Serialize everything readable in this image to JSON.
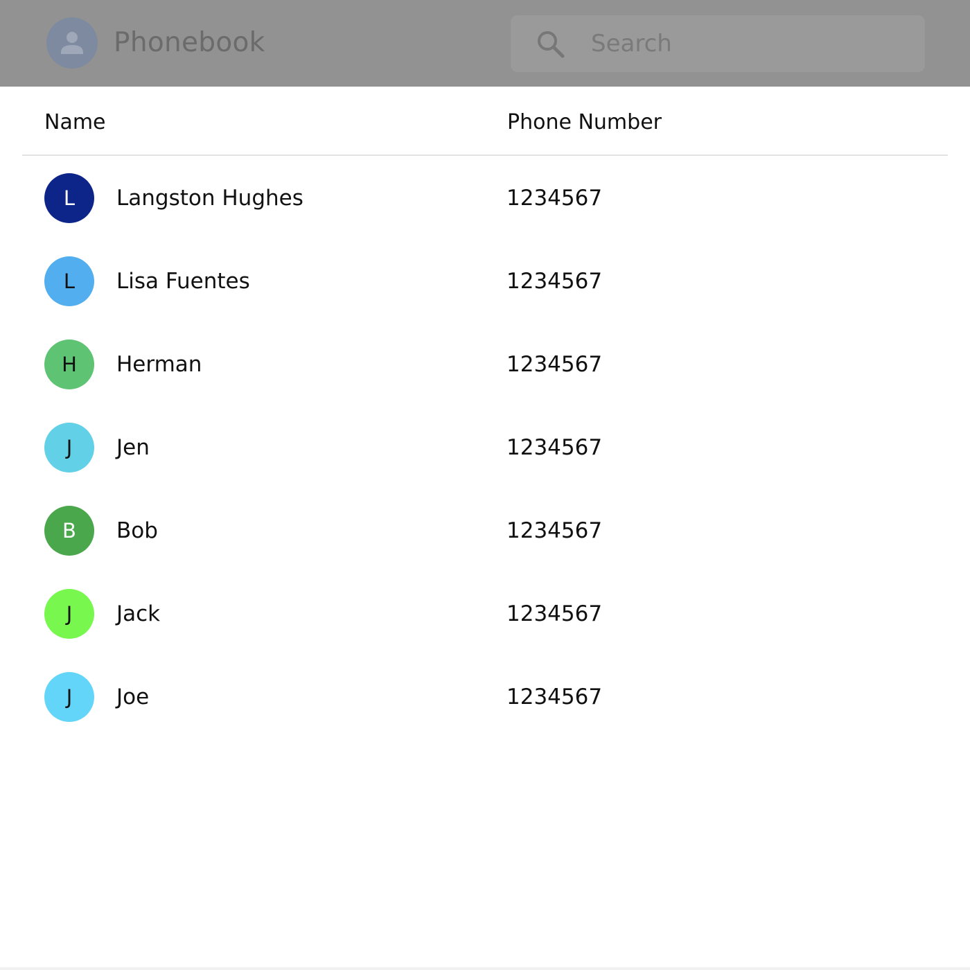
{
  "header": {
    "title": "Phonebook",
    "search_placeholder": "Search",
    "colors": {
      "bar": "#929292",
      "avatar": "#7e8aa0"
    }
  },
  "table": {
    "columns": {
      "name": "Name",
      "phone": "Phone Number"
    },
    "rows": [
      {
        "initial": "L",
        "name": "Langston Hughes",
        "phone": "1234567",
        "color": "#0d2489",
        "text_color": "#ffffff"
      },
      {
        "initial": "L",
        "name": "Lisa Fuentes",
        "phone": "1234567",
        "color": "#52aeee",
        "text_color": "#111111"
      },
      {
        "initial": "H",
        "name": "Herman",
        "phone": "1234567",
        "color": "#5ec372",
        "text_color": "#111111"
      },
      {
        "initial": "J",
        "name": "Jen",
        "phone": "1234567",
        "color": "#62d0e6",
        "text_color": "#111111"
      },
      {
        "initial": "B",
        "name": "Bob",
        "phone": "1234567",
        "color": "#4ba74b",
        "text_color": "#ffffff"
      },
      {
        "initial": "J",
        "name": "Jack",
        "phone": "1234567",
        "color": "#78f84f",
        "text_color": "#111111"
      },
      {
        "initial": "J",
        "name": "Joe",
        "phone": "1234567",
        "color": "#63d5f9",
        "text_color": "#111111"
      }
    ]
  }
}
